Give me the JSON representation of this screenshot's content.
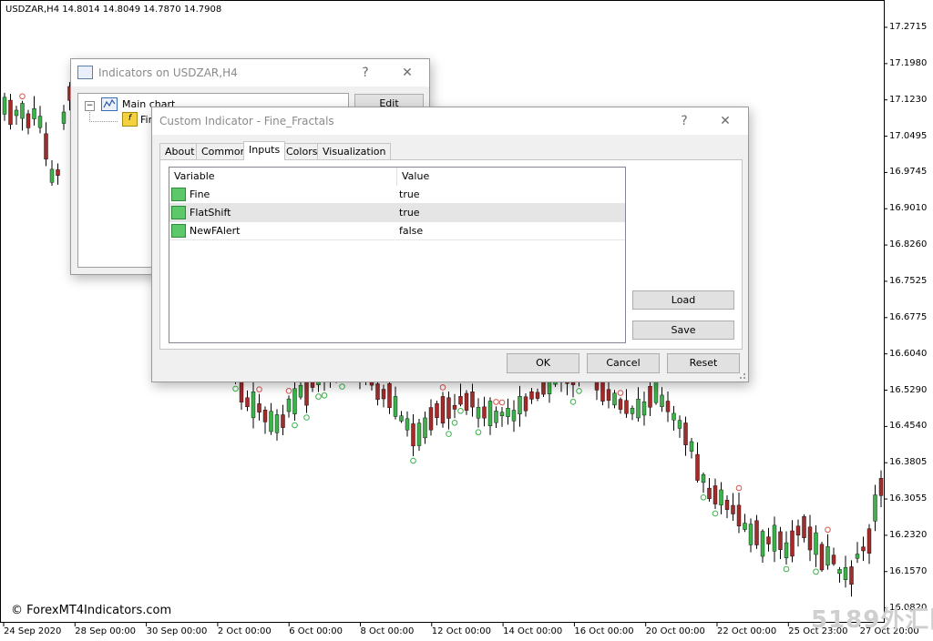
{
  "chart": {
    "symbol_info": "USDZAR,H4  14.8014 14.8049 14.7870 14.7908",
    "watermark": "© ForexMT4Indicators.com",
    "watermark_cn": "5189外汇网",
    "price_labels": [
      "17.2715",
      "17.1980",
      "17.1230",
      "17.0495",
      "16.9745",
      "16.9010",
      "16.8260",
      "16.7525",
      "16.6775",
      "16.6040",
      "16.5290",
      "16.4540",
      "16.3805",
      "16.3055",
      "16.2320",
      "16.1570",
      "16.0820"
    ],
    "date_labels": [
      "24 Sep 2020",
      "28 Sep 00:00",
      "30 Sep 00:00",
      "2 Oct 00:00",
      "6 Oct 00:00",
      "8 Oct 00:00",
      "12 Oct 00:00",
      "14 Oct 00:00",
      "16 Oct 00:00",
      "20 Oct 00:00",
      "22 Oct 00:00",
      "25 Oct 23:00",
      "27 Oct 20:00"
    ],
    "colors": {
      "bull": "#3cb34a",
      "bear": "#a52a2a",
      "wick": "#000000",
      "fractal_up": "#d9534f",
      "fractal_down": "#3cb34a"
    }
  },
  "window_indicators": {
    "title": "Indicators on USDZAR,H4",
    "help": "?",
    "close": "✕",
    "tree_root": "Main chart",
    "tree_child": "Fin",
    "edit_button": "Edit"
  },
  "window_custom": {
    "title": "Custom Indicator - Fine_Fractals",
    "help": "?",
    "close": "✕",
    "tabs": [
      "About",
      "Common",
      "Inputs",
      "Colors",
      "Visualization"
    ],
    "active_tab": "Inputs",
    "table": {
      "col_variable": "Variable",
      "col_value": "Value",
      "rows": [
        {
          "variable": "Fine",
          "value": "true"
        },
        {
          "variable": "FlatShift",
          "value": "true"
        },
        {
          "variable": "NewFAlert",
          "value": "false"
        }
      ]
    },
    "load_button": "Load",
    "save_button": "Save",
    "ok_button": "OK",
    "cancel_button": "Cancel",
    "reset_button": "Reset"
  }
}
